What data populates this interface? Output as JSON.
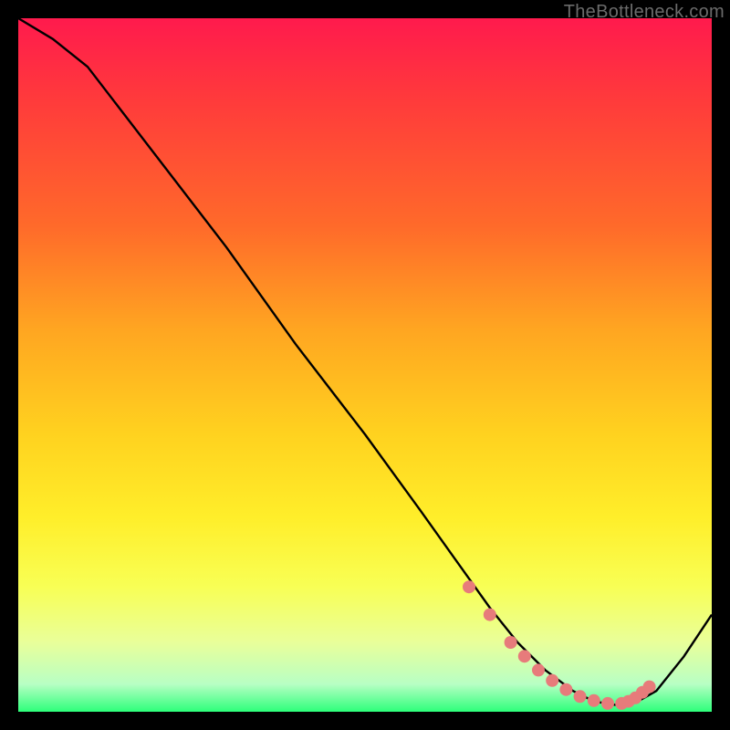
{
  "watermark": "TheBottleneck.com",
  "chart_data": {
    "type": "line",
    "title": "",
    "xlabel": "",
    "ylabel": "",
    "xlim": [
      0,
      100
    ],
    "ylim": [
      0,
      100
    ],
    "grid": false,
    "series": [
      {
        "name": "curve",
        "x": [
          0,
          5,
          10,
          20,
          30,
          40,
          50,
          58,
          63,
          68,
          72,
          76,
          80,
          83,
          86,
          89,
          92,
          96,
          100
        ],
        "y": [
          100,
          97,
          93,
          80,
          67,
          53,
          40,
          29,
          22,
          15,
          10,
          6,
          3,
          1.5,
          1,
          1.3,
          3,
          8,
          14
        ],
        "color": "#000000"
      },
      {
        "name": "dots",
        "type": "scatter",
        "x": [
          65,
          68,
          71,
          73,
          75,
          77,
          79,
          81,
          83,
          85,
          87,
          88,
          89,
          90,
          91
        ],
        "y": [
          18,
          14,
          10,
          8,
          6,
          4.5,
          3.2,
          2.2,
          1.6,
          1.2,
          1.2,
          1.5,
          2,
          2.8,
          3.6
        ],
        "color": "#e77b7b",
        "radius": 7
      }
    ]
  }
}
